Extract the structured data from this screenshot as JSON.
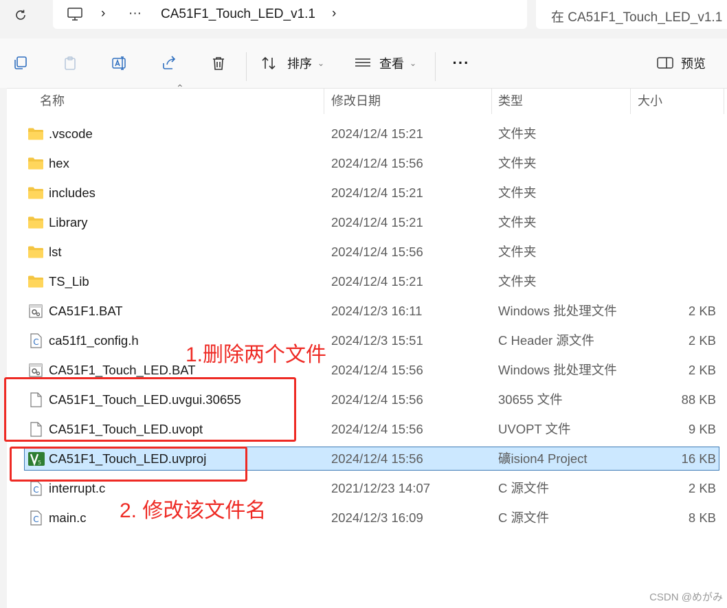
{
  "address": {
    "folder": "CA51F1_Touch_LED_v1.1",
    "overflow": "···",
    "search_text": "在 CA51F1_Touch_LED_v1.1"
  },
  "toolbar": {
    "sort_label": "排序",
    "view_label": "查看",
    "more_label": "···",
    "preview_label": "预览"
  },
  "columns": {
    "name": "名称",
    "date": "修改日期",
    "type": "类型",
    "size": "大小"
  },
  "files": [
    {
      "name": ".vscode",
      "date": "2024/12/4 15:21",
      "type": "文件夹",
      "size": "",
      "icon": "folder-icon"
    },
    {
      "name": "hex",
      "date": "2024/12/4 15:56",
      "type": "文件夹",
      "size": "",
      "icon": "folder-icon"
    },
    {
      "name": "includes",
      "date": "2024/12/4 15:21",
      "type": "文件夹",
      "size": "",
      "icon": "folder-icon"
    },
    {
      "name": "Library",
      "date": "2024/12/4 15:21",
      "type": "文件夹",
      "size": "",
      "icon": "folder-icon"
    },
    {
      "name": "lst",
      "date": "2024/12/4 15:56",
      "type": "文件夹",
      "size": "",
      "icon": "folder-icon"
    },
    {
      "name": "TS_Lib",
      "date": "2024/12/4 15:21",
      "type": "文件夹",
      "size": "",
      "icon": "folder-icon"
    },
    {
      "name": "CA51F1.BAT",
      "date": "2024/12/3 16:11",
      "type": "Windows 批处理文件",
      "size": "2 KB",
      "icon": "batch-file-icon"
    },
    {
      "name": "ca51f1_config.h",
      "date": "2024/12/3 15:51",
      "type": "C Header 源文件",
      "size": "2 KB",
      "icon": "c-source-icon"
    },
    {
      "name": "CA51F1_Touch_LED.BAT",
      "date": "2024/12/4 15:56",
      "type": "Windows 批处理文件",
      "size": "2 KB",
      "icon": "batch-file-icon"
    },
    {
      "name": "CA51F1_Touch_LED.uvgui.30655",
      "date": "2024/12/4 15:56",
      "type": "30655 文件",
      "size": "88 KB",
      "icon": "blank-file-icon"
    },
    {
      "name": "CA51F1_Touch_LED.uvopt",
      "date": "2024/12/4 15:56",
      "type": "UVOPT 文件",
      "size": "9 KB",
      "icon": "blank-file-icon"
    },
    {
      "name": "CA51F1_Touch_LED.uvproj",
      "date": "2024/12/4 15:56",
      "type": "礦ision4 Project",
      "size": "16 KB",
      "icon": "uvision-project-icon",
      "selected": true
    },
    {
      "name": "interrupt.c",
      "date": "2021/12/23 14:07",
      "type": "C 源文件",
      "size": "2 KB",
      "icon": "c-source-icon"
    },
    {
      "name": "main.c",
      "date": "2024/12/3 16:09",
      "type": "C 源文件",
      "size": "8 KB",
      "icon": "c-source-icon"
    }
  ],
  "annotations": {
    "delete_note": "1.删除两个文件",
    "rename_note": "2. 修改该文件名"
  },
  "watermark": "CSDN @めがみ",
  "colors": {
    "annotation_red": "#ee2a24",
    "selection_bg": "#cce8ff",
    "selection_border": "#3d7ab5",
    "folder_yellow": "#f4c542"
  }
}
